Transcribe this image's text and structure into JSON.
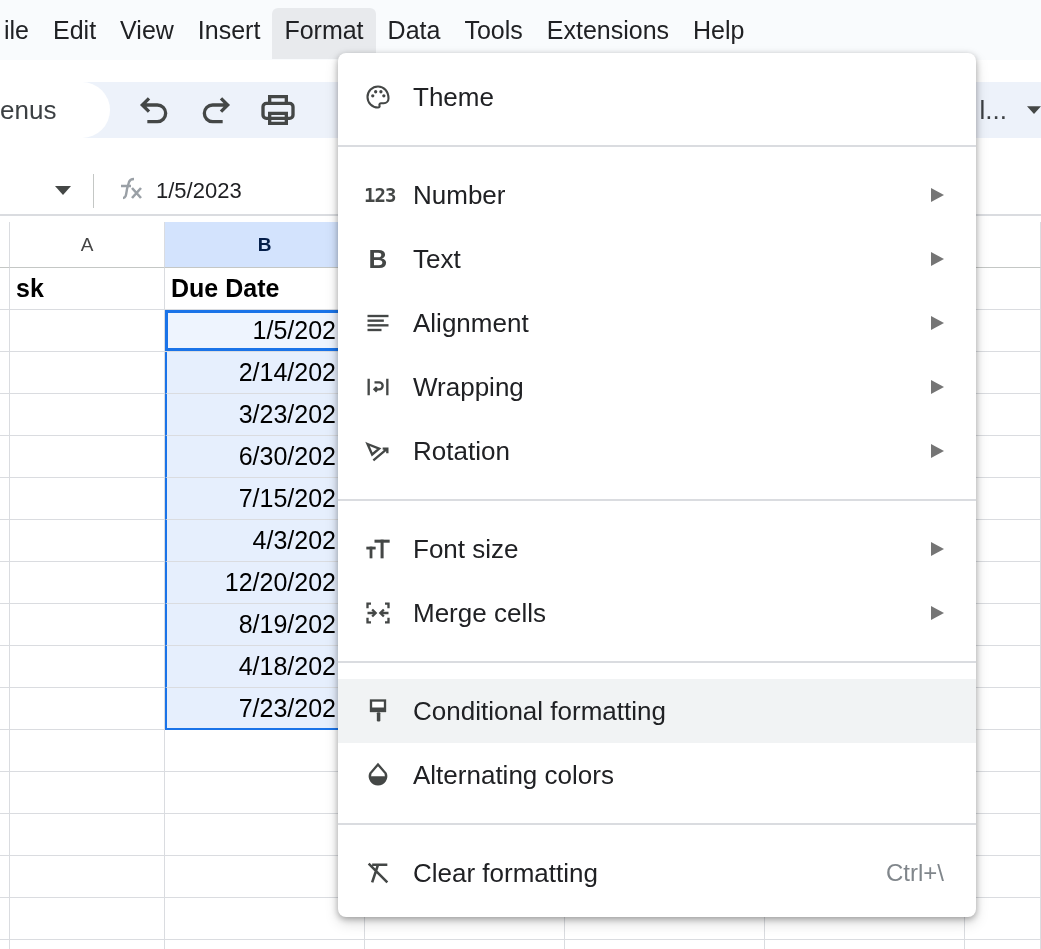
{
  "menubar": [
    {
      "label": "ile",
      "selected": false
    },
    {
      "label": "Edit",
      "selected": false
    },
    {
      "label": "View",
      "selected": false
    },
    {
      "label": "Insert",
      "selected": false
    },
    {
      "label": "Format",
      "selected": true
    },
    {
      "label": "Data",
      "selected": false
    },
    {
      "label": "Tools",
      "selected": false
    },
    {
      "label": "Extensions",
      "selected": false
    },
    {
      "label": "Help",
      "selected": false
    }
  ],
  "toolbar": {
    "search": "enus",
    "font_label": "l..."
  },
  "formula_bar": {
    "value": "1/5/2023"
  },
  "sheet": {
    "columns": [
      {
        "label": "A",
        "selected": false
      },
      {
        "label": "B",
        "selected": true
      }
    ],
    "header_row": [
      "sk",
      "Due Date"
    ],
    "due_dates": [
      {
        "value": "1/5/202",
        "selected": true,
        "active": true
      },
      {
        "value": "2/14/202",
        "selected": true,
        "active": false
      },
      {
        "value": "3/23/202",
        "selected": true,
        "active": false
      },
      {
        "value": "6/30/202",
        "selected": true,
        "active": false
      },
      {
        "value": "7/15/202",
        "selected": true,
        "active": false
      },
      {
        "value": "4/3/202",
        "selected": true,
        "active": false
      },
      {
        "value": "12/20/202",
        "selected": true,
        "active": false
      },
      {
        "value": "8/19/202",
        "selected": true,
        "active": false
      },
      {
        "value": "4/18/202",
        "selected": true,
        "active": false
      },
      {
        "value": "7/23/202",
        "selected": true,
        "active": false
      }
    ]
  },
  "format_menu": {
    "sections": [
      [
        {
          "label": "Theme",
          "kind": "palette",
          "submenu": false,
          "highlighted": false
        }
      ],
      [
        {
          "label": "Number",
          "kind": "digits",
          "icon_text": "123",
          "submenu": true,
          "highlighted": false
        },
        {
          "label": "Text",
          "kind": "letter",
          "icon_text": "B",
          "submenu": true,
          "highlighted": false
        },
        {
          "label": "Alignment",
          "kind": "align",
          "submenu": true,
          "highlighted": false
        },
        {
          "label": "Wrapping",
          "kind": "wrap",
          "submenu": true,
          "highlighted": false
        },
        {
          "label": "Rotation",
          "kind": "rotate",
          "submenu": true,
          "highlighted": false
        }
      ],
      [
        {
          "label": "Font size",
          "kind": "fontsize",
          "submenu": true,
          "highlighted": false
        },
        {
          "label": "Merge cells",
          "kind": "merge",
          "submenu": true,
          "highlighted": false
        }
      ],
      [
        {
          "label": "Conditional formatting",
          "kind": "brush",
          "submenu": false,
          "highlighted": true
        },
        {
          "label": "Alternating colors",
          "kind": "drop",
          "submenu": false,
          "highlighted": false
        }
      ],
      [
        {
          "label": "Clear formatting",
          "kind": "clear",
          "submenu": false,
          "highlighted": false,
          "shortcut": "Ctrl+\\"
        }
      ]
    ]
  }
}
